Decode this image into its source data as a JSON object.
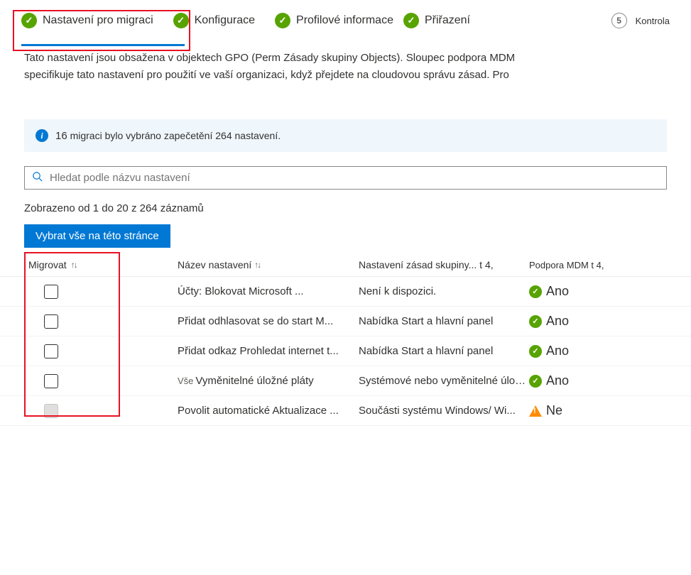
{
  "stepper": {
    "steps": [
      {
        "label": "Nastavení pro migraci",
        "done": true,
        "active": true
      },
      {
        "label": "Konfigurace",
        "done": true
      },
      {
        "label": "Profilové informace",
        "done": true
      },
      {
        "label": "Přiřazení",
        "done": true
      },
      {
        "label": "Kontrola",
        "done": false,
        "number": "5"
      }
    ]
  },
  "description": {
    "line1": "Tato nastavení jsou obsažena v objektech GPO (Perm Zásady skupiny Objects). Sloupec podpora MDM",
    "line2": "specifikuje tato nastavení pro použití ve vaší organizaci, když přejdete na cloudovou správu zásad. Pro"
  },
  "banner": {
    "count": "16",
    "mid": "migraci bylo vybráno zapečetění",
    "total": "264",
    "suffix": "nastavení."
  },
  "search": {
    "placeholder": "Hledat podle názvu nastavení"
  },
  "records_line": "Zobrazeno od 1 do 20 z 264 záznamů",
  "select_all_btn": "Vybrat vše na této stránce",
  "columns": {
    "migrate": "Migrovat",
    "name": "Název nastavení",
    "gpo": "Nastavení zásad skupiny... t 4,",
    "mdm": "Podpora MDM t 4,"
  },
  "rows": [
    {
      "name": "Účty: Blokovat Microsoft ...",
      "gpo": "Není k dispozici.",
      "mdm": "Ano",
      "status": "ok",
      "disabled": false
    },
    {
      "name": "Přidat odhlasovat se do start M...",
      "gpo": "Nabídka Start a hlavní panel",
      "mdm": "Ano",
      "status": "ok",
      "disabled": false
    },
    {
      "name": "Přidat odkaz Prohledat internet t...",
      "gpo": "Nabídka Start a hlavní panel",
      "mdm": "Ano",
      "status": "ok",
      "disabled": false
    },
    {
      "prefix": "Vše",
      "name": "Vyměnitelné úložné pláty",
      "gpo": "Systémové nebo vyměnitelné úložiště",
      "mdm": "Ano",
      "status": "ok",
      "disabled": false
    },
    {
      "name": "Povolit automatické Aktualizace ...",
      "gpo": "Součásti systému Windows/ Wi...",
      "mdm": "Ne",
      "status": "warn",
      "disabled": true
    }
  ]
}
